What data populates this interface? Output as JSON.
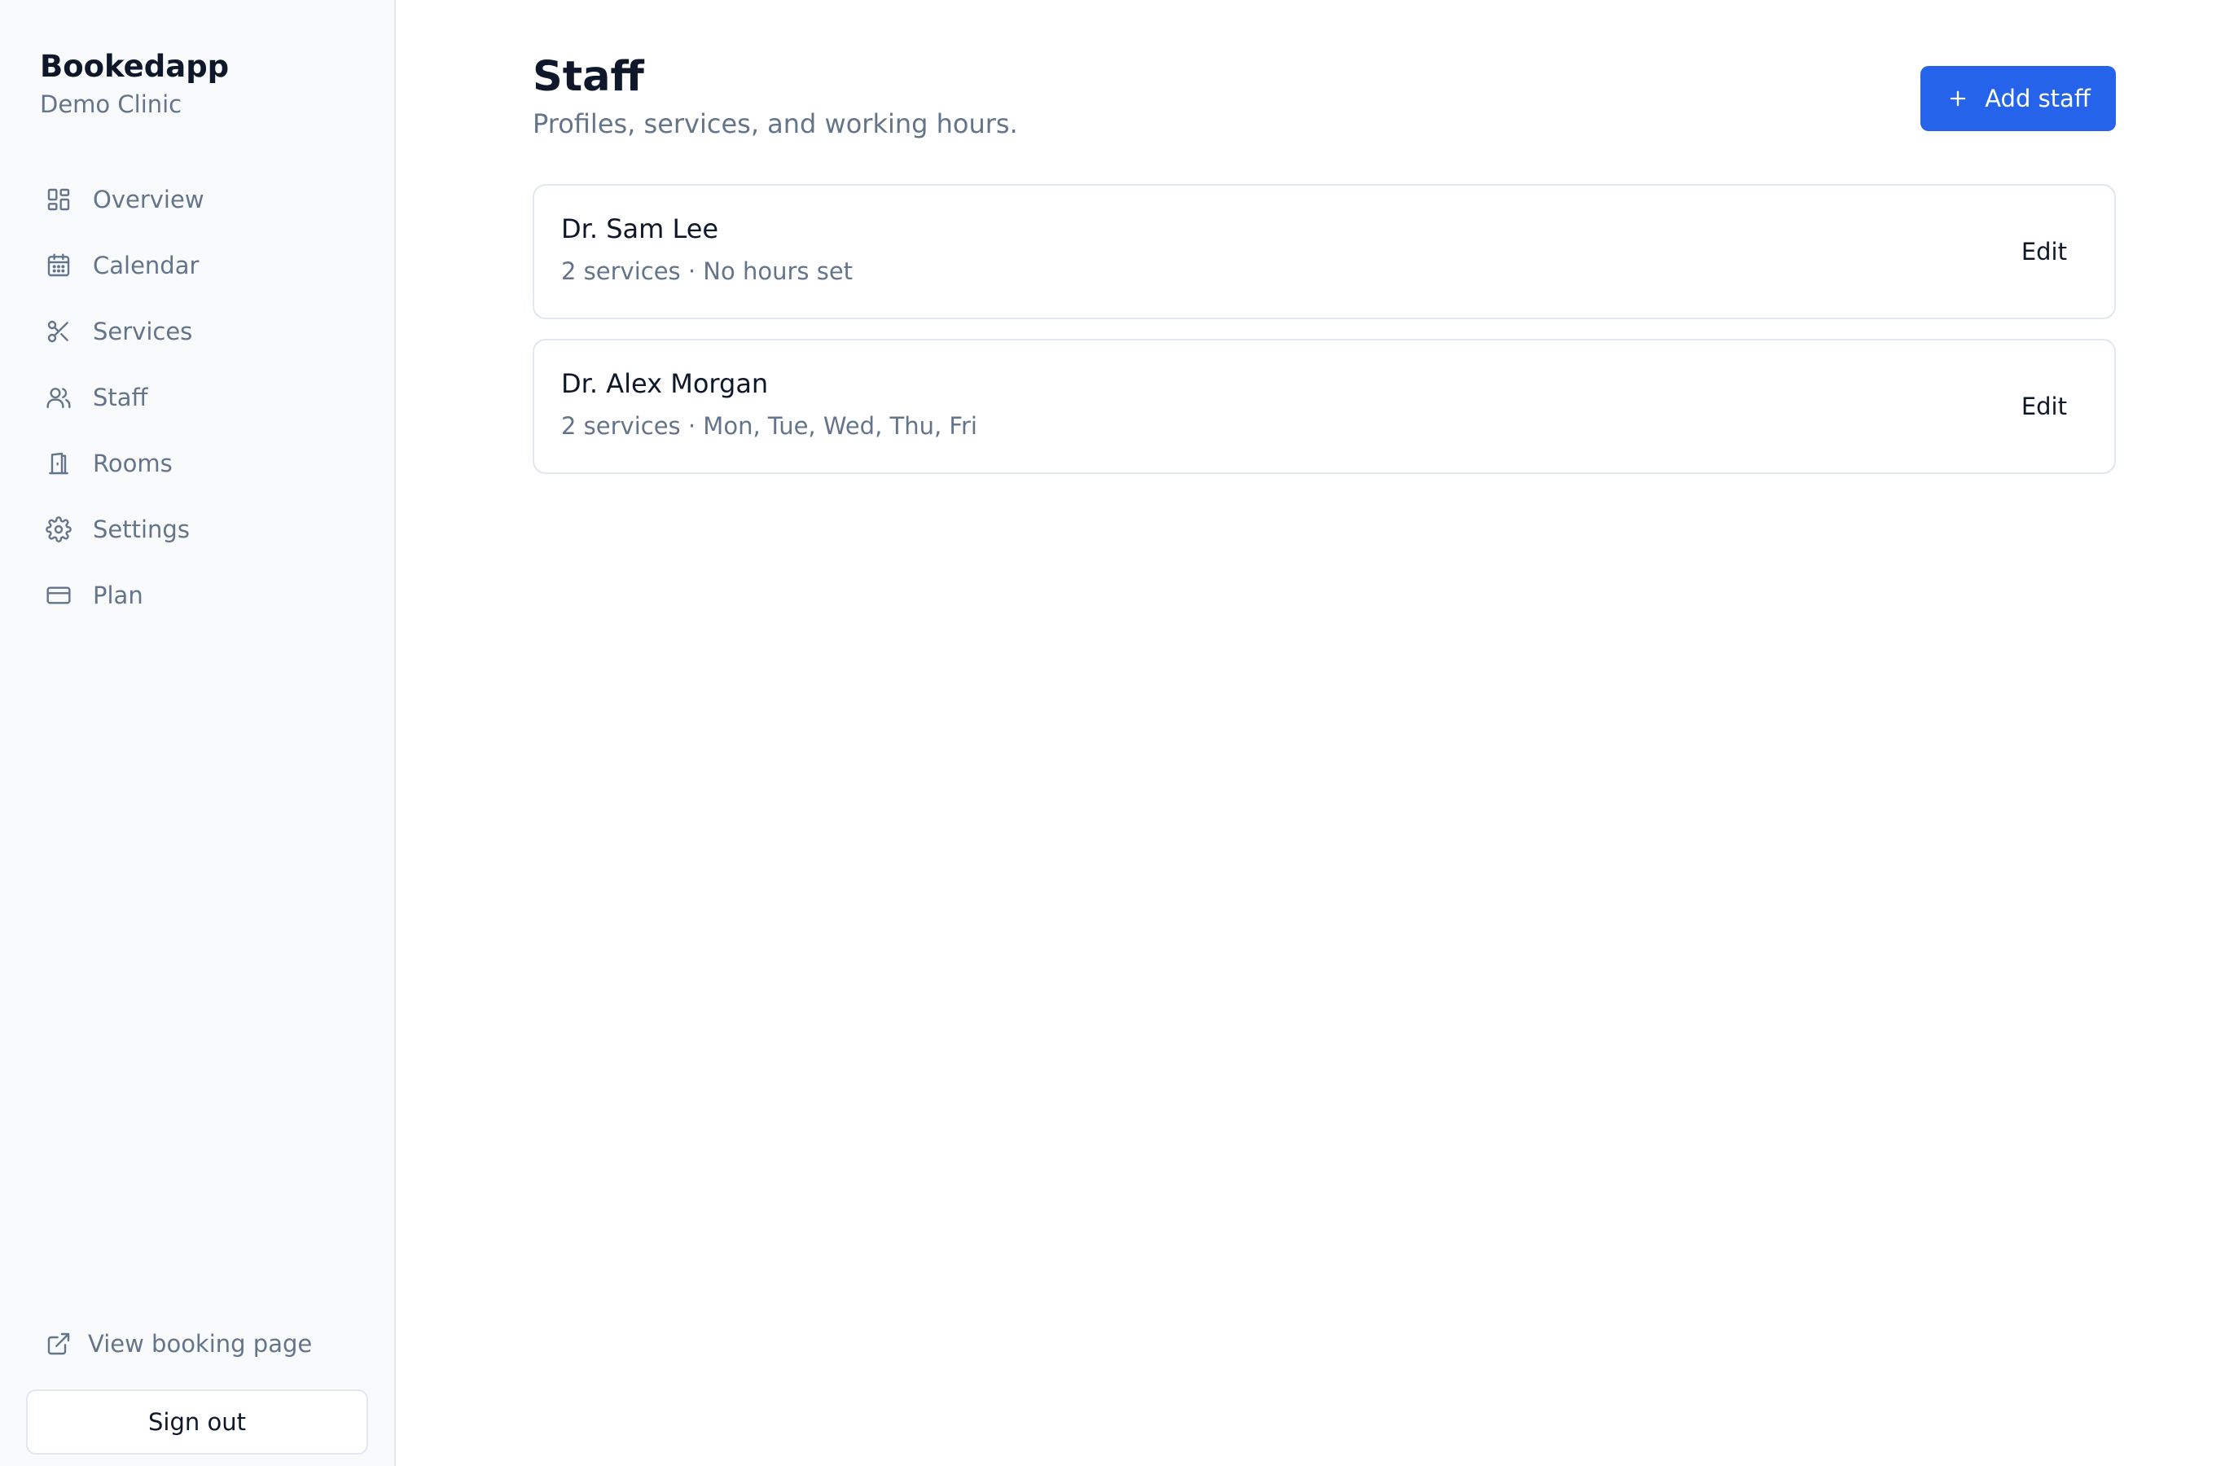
{
  "brand": {
    "name": "Bookedapp",
    "subtitle": "Demo Clinic"
  },
  "sidebar": {
    "items": [
      {
        "label": "Overview",
        "icon": "overview-icon"
      },
      {
        "label": "Calendar",
        "icon": "calendar-icon"
      },
      {
        "label": "Services",
        "icon": "scissors-icon"
      },
      {
        "label": "Staff",
        "icon": "users-icon"
      },
      {
        "label": "Rooms",
        "icon": "door-icon"
      },
      {
        "label": "Settings",
        "icon": "gear-icon"
      },
      {
        "label": "Plan",
        "icon": "credit-card-icon"
      }
    ],
    "view_booking_label": "View booking page",
    "sign_out_label": "Sign out"
  },
  "header": {
    "title": "Staff",
    "subtitle": "Profiles, services, and working hours.",
    "add_button_label": "Add staff"
  },
  "staff": [
    {
      "name": "Dr. Sam Lee",
      "meta": "2 services · No hours set",
      "edit_label": "Edit"
    },
    {
      "name": "Dr. Alex Morgan",
      "meta": "2 services · Mon, Tue, Wed, Thu, Fri",
      "edit_label": "Edit"
    }
  ],
  "colors": {
    "accent": "#2563eb",
    "sidebar_bg": "#f8fafc",
    "muted_text": "#64748b",
    "text": "#0f172a",
    "border": "#e2e8f0"
  }
}
